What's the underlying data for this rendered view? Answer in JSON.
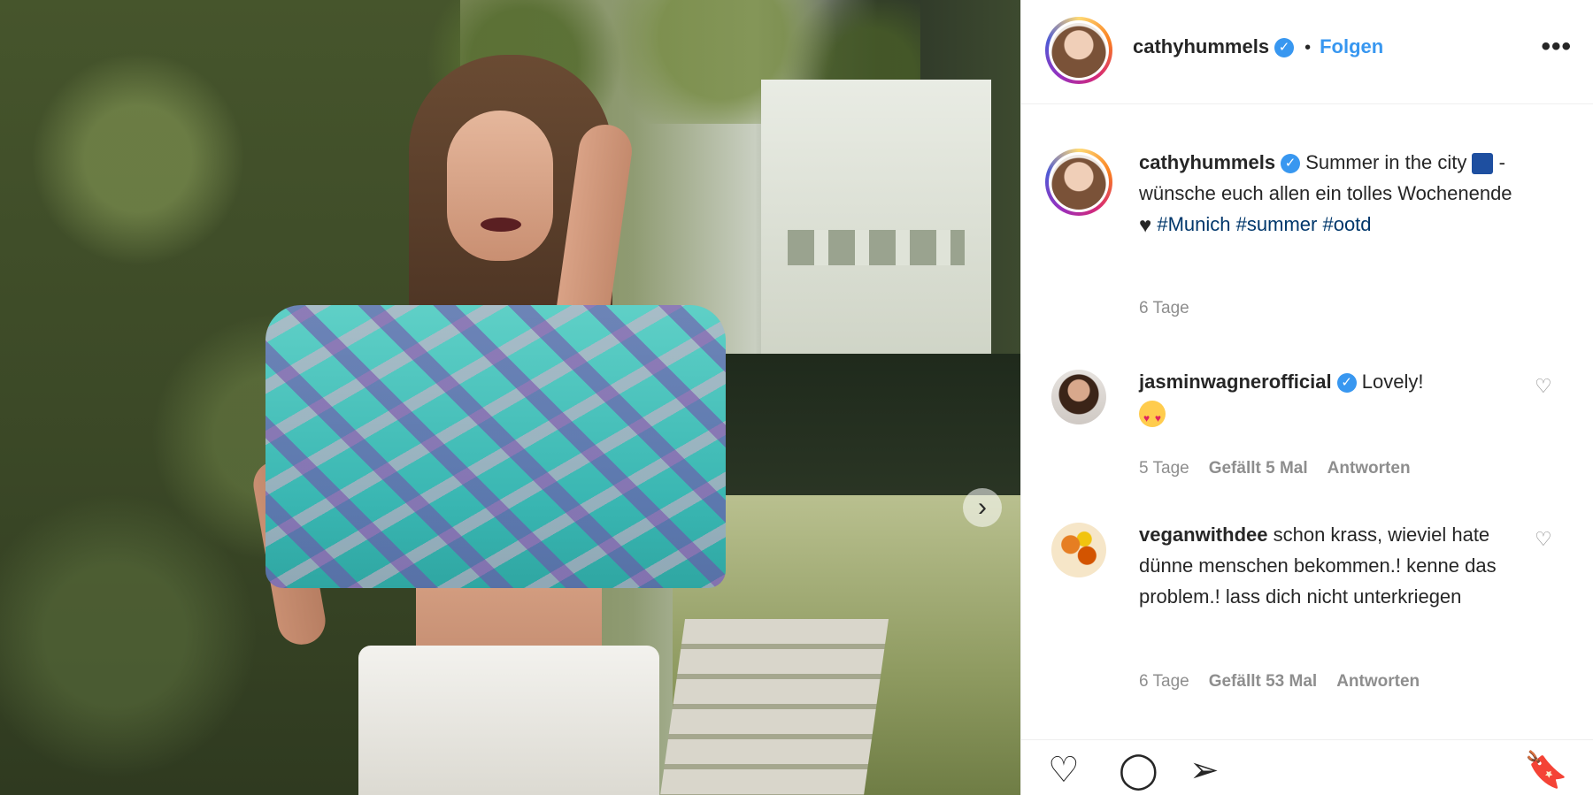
{
  "post": {
    "author": "cathyhummels",
    "follow_label": "Folgen",
    "separator": "•",
    "more_label": "•••",
    "caption_text_1": "Summer in the city",
    "caption_text_2": "- wünsche euch allen ein tolles Wochenende",
    "hashtags": [
      "#Munich",
      "#summer",
      "#ootd"
    ],
    "time": "6 Tage"
  },
  "comments": [
    {
      "username": "jasminwagnerofficial",
      "verified": true,
      "text": "Lovely!",
      "time": "5 Tage",
      "likes": "Gefällt 5 Mal",
      "reply": "Antworten"
    },
    {
      "username": "veganwithdee",
      "verified": false,
      "text": "schon krass, wieviel hate dünne menschen bekommen.! kenne das problem.! lass dich nicht unterkriegen",
      "time": "6 Tage",
      "likes": "Gefällt 53 Mal",
      "reply": "Antworten"
    }
  ],
  "icons": {
    "verified": "verified-badge-icon",
    "more": "more-options-icon",
    "like": "heart-icon",
    "comment": "comment-icon",
    "share": "paper-plane-icon",
    "save": "bookmark-icon",
    "carousel": "chevron-right-icon"
  },
  "colors": {
    "link": "#3897f0",
    "hashtag": "#00376b",
    "muted": "#8e8e8e",
    "text": "#262626"
  }
}
